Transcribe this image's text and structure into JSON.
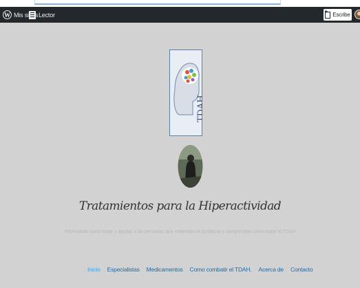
{
  "adminbar": {
    "my_sites": "Mis sitios",
    "reader": "Lector",
    "write": "Escribe"
  },
  "site": {
    "title": "Tratamientos para la Hiperactividad",
    "tagline": "Informando como tratar y ayudar a las personas que entiendan el problema y comprendan como tratar el TDAH",
    "logo_text": "TDAH"
  },
  "menu": {
    "items": [
      {
        "label": "Inicio",
        "active": true
      },
      {
        "label": "Especialistas",
        "active": false
      },
      {
        "label": "Medicamentos",
        "active": false
      },
      {
        "label": "Como combatir el TDAH.",
        "active": false
      },
      {
        "label": "Acerca de",
        "active": false
      },
      {
        "label": "Contacto",
        "active": false
      }
    ]
  },
  "colors": {
    "page_bg": "#d2d2d2",
    "adminbar_bg": "#23282d",
    "menu_link": "#1f6ba3",
    "menu_active": "#3ea6e6"
  }
}
